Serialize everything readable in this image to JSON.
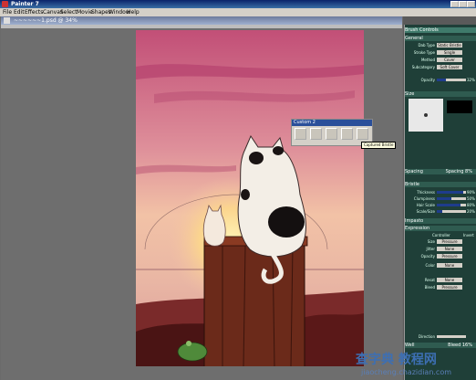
{
  "app": {
    "title": "Painter 7"
  },
  "menu": [
    "File",
    "Edit",
    "Effects",
    "Canvas",
    "Select",
    "Movie",
    "Shapes",
    "Window",
    "Help"
  ],
  "document": {
    "title": "~~~~~~1.psd @ 34%"
  },
  "brush_controls": {
    "title": "Brush Controls",
    "sections": {
      "general": "General",
      "size": "Size",
      "spacing": "Spacing",
      "bristle": "Bristle",
      "impasto": "Impasto",
      "expression": "Expression",
      "well": "Well"
    },
    "general": {
      "dab_type_label": "Dab Type",
      "dab_type": "Static Bristle",
      "stroke_type_label": "Stroke Type",
      "stroke_type": "Single",
      "method_label": "Method",
      "method": "Cover",
      "subcategory_label": "Subcategory",
      "subcategory": "Soft Cover",
      "opacity_label": "Opacity",
      "opacity_value": "32%",
      "opacity_fill": 0.32
    },
    "spacing_value": "Spacing 8%",
    "bristle": {
      "thickness_label": "Thickness",
      "thickness_value": "90%",
      "thickness_fill": 0.9,
      "clumpiness_label": "Clumpiness",
      "clumpiness_value": "50%",
      "clumpiness_fill": 0.5,
      "hair_scale_label": "Hair Scale",
      "hair_scale_value": "80%",
      "hair_scale_fill": 0.8,
      "scale_size_label": "Scale/Size",
      "scale_size_value": "20%",
      "scale_size_fill": 0.2
    },
    "expression": {
      "controller_header": "Controller",
      "invert_header": "Invert",
      "size_label": "Size",
      "size": "Pressure",
      "jitter_label": "Jitter",
      "jitter": "None",
      "opacity_label": "Opacity",
      "opacity": "Pressure",
      "color_label": "Color",
      "color": "None",
      "resat_label": "Resat",
      "resat": "None",
      "bleed_label": "Bleed",
      "bleed": "Pressure",
      "direction_label": "Direction"
    },
    "well_value": "Bleed 16%"
  },
  "custom_palette": {
    "title": "Custom 2"
  },
  "tooltip": "Captured Bristle",
  "watermark": {
    "line1": "查字典 教程网",
    "line2": "jiaocheng.chazidian.com"
  },
  "colors": {
    "panel_bg": "#1f3f38",
    "panel_header": "#2f5b50",
    "accent": "#0a246a",
    "sky_top": "#c8607e",
    "sky_mid": "#e9a8a0",
    "sun": "#fde7a3"
  }
}
